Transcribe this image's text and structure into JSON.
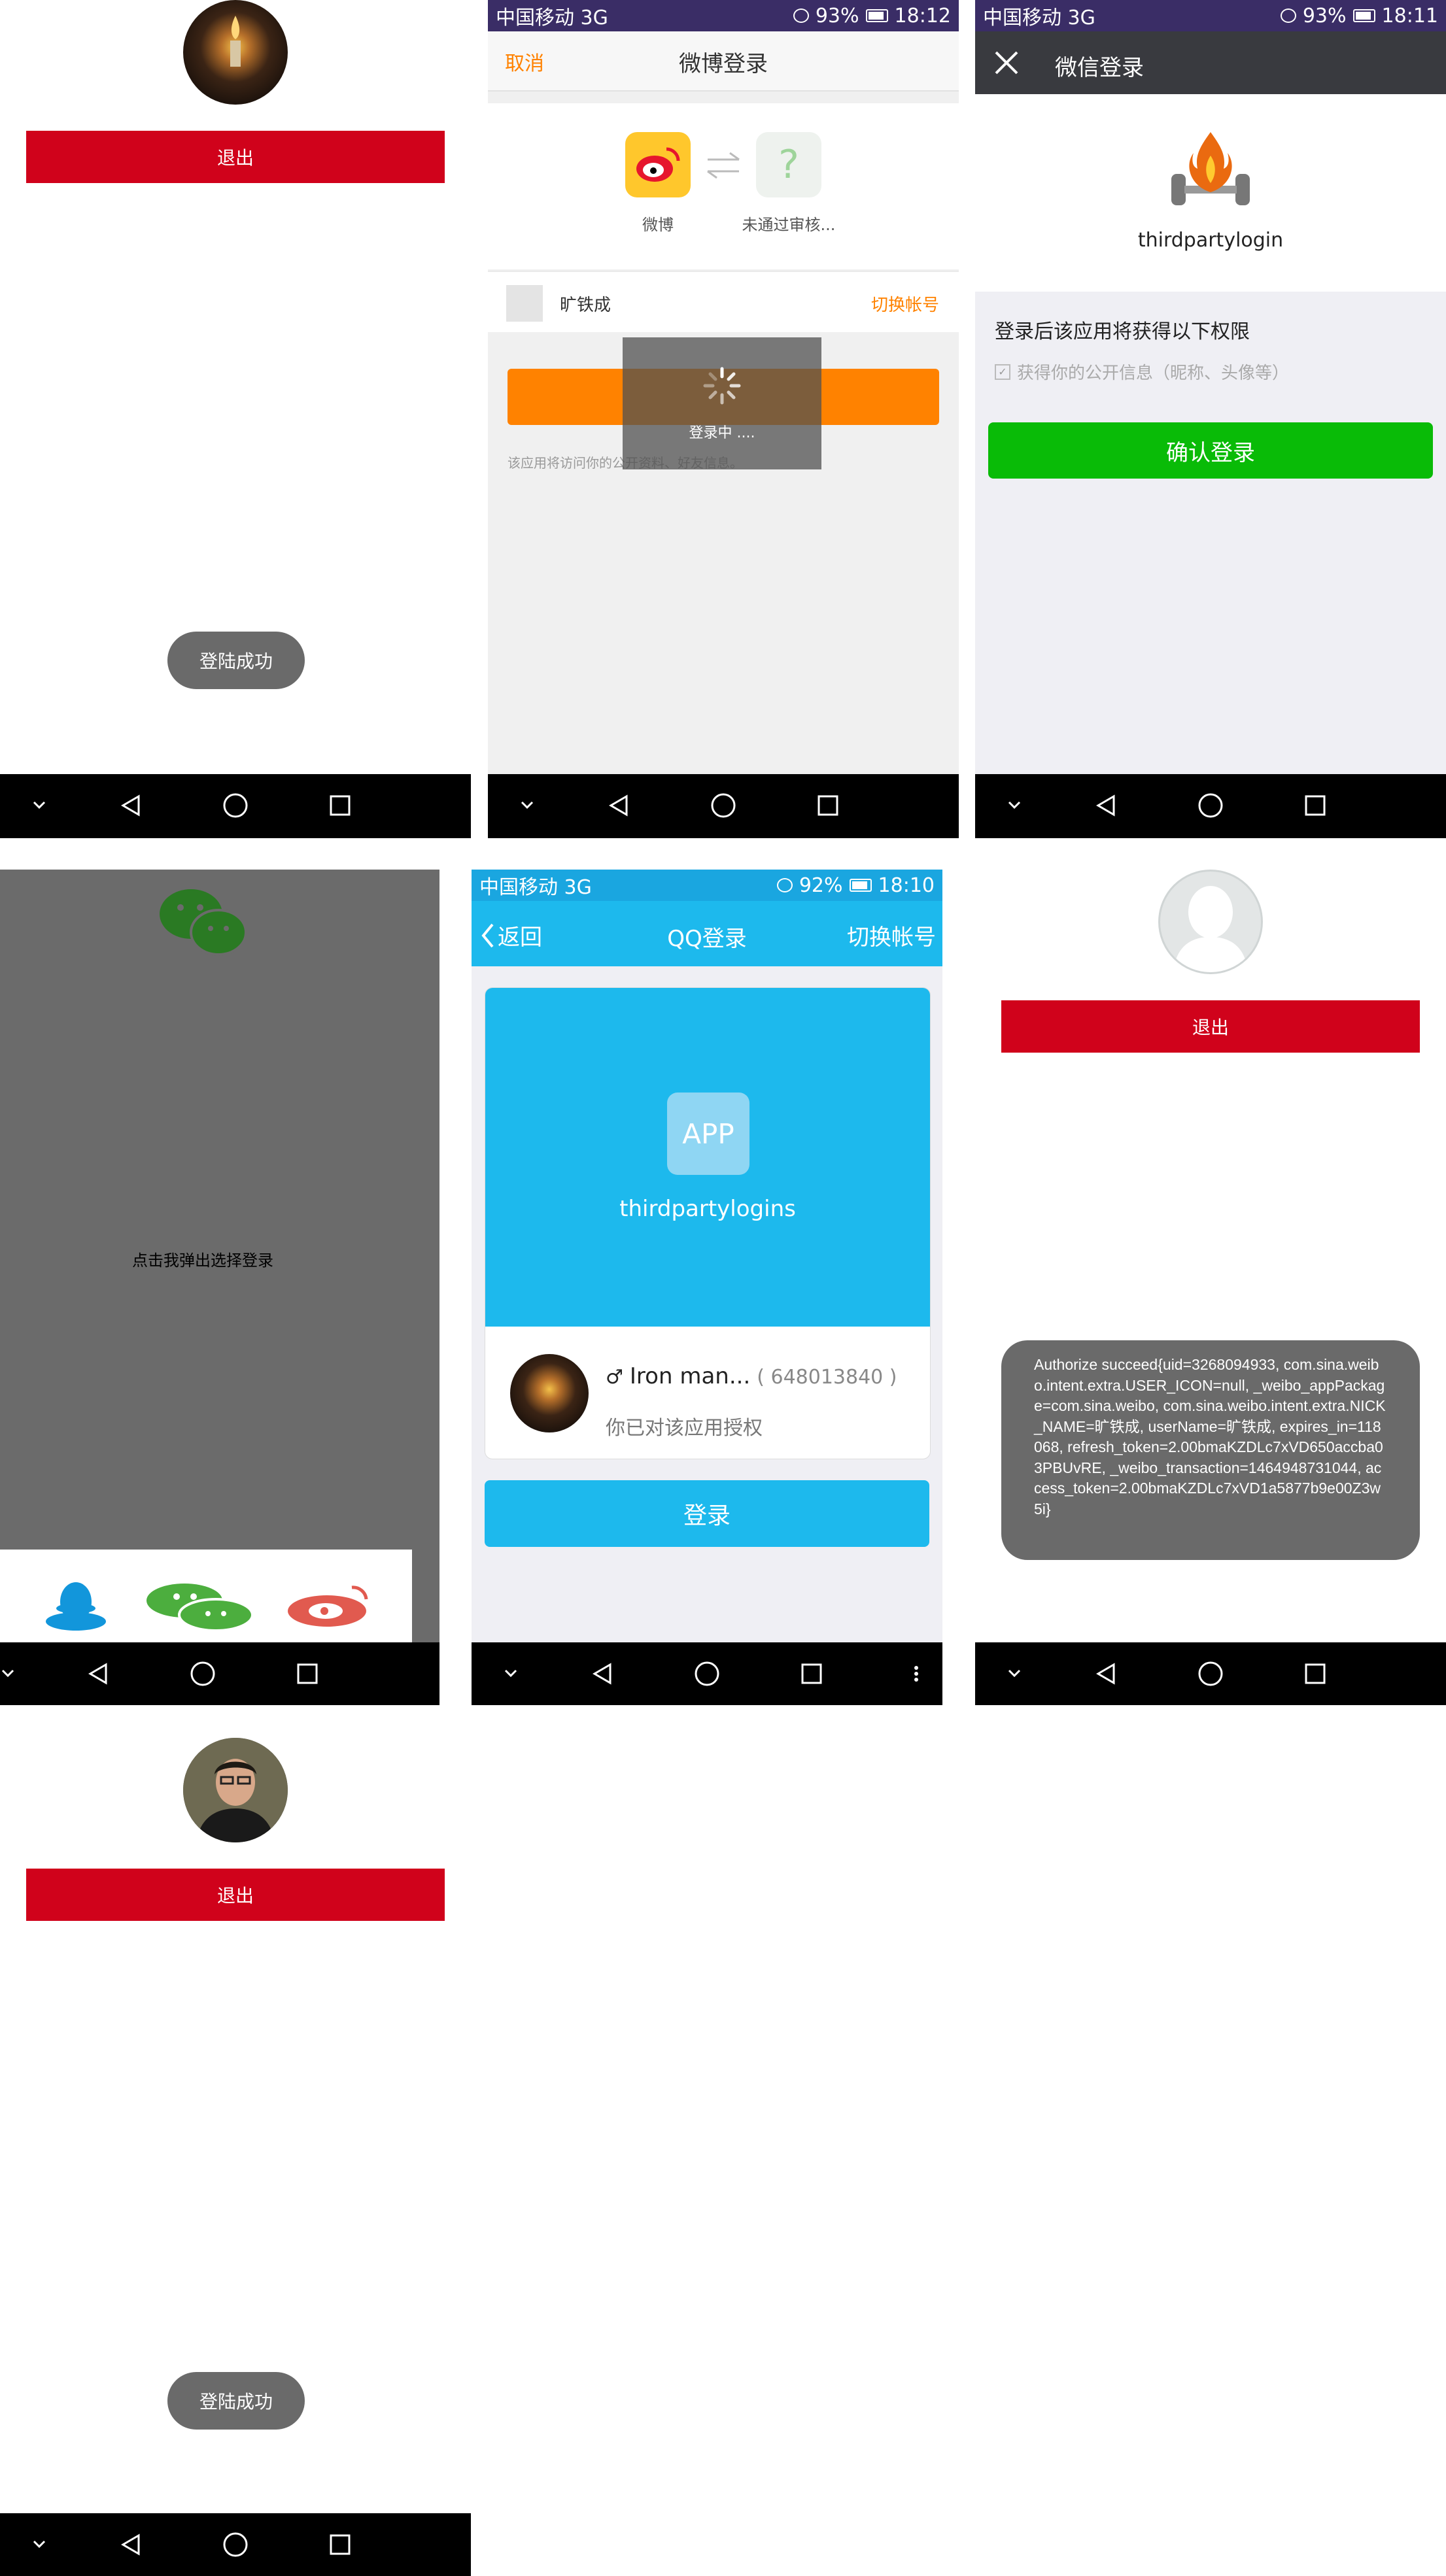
{
  "colors": {
    "red": "#d0021b",
    "weibo_orange": "#ff8200",
    "wechat_green": "#09bb07",
    "qq_blue": "#1db9ed",
    "statusbar_purple": "#3a2d66",
    "toast_gray": "#6a6a6a",
    "overlay_gray": "#6b6b6b"
  },
  "panel1": {
    "avatar_icon": "candle-avatar-icon",
    "logout_label": "退出",
    "toast": "登陆成功"
  },
  "weibo": {
    "status_left": "中国移动 3G",
    "status_battery": "93%",
    "status_time": "18:12",
    "cancel": "取消",
    "title": "微博登录",
    "app1_label": "微博",
    "app2_label": "未通过审核...",
    "user_name": "旷铁成",
    "switch_account": "切换帐号",
    "loading": "登录中 ....",
    "note": "该应用将访问你的公开资料、好友信息。"
  },
  "wechat": {
    "status_left": "中国移动 3G",
    "status_battery": "93%",
    "status_time": "18:11",
    "title": "微信登录",
    "app_name": "thirdpartylogin",
    "perm_title": "登录后该应用将获得以下权限",
    "perm_item": "获得你的公开信息（昵称、头像等）",
    "confirm": "确认登录"
  },
  "chooser": {
    "center_text": "点击我弹出选择登录",
    "icons": [
      "qq-icon",
      "wechat-icon",
      "weibo-icon"
    ]
  },
  "qq": {
    "status_left": "中国移动 3G",
    "status_battery": "92%",
    "status_time": "18:10",
    "back": "返回",
    "title": "QQ登录",
    "switch_account": "切换帐号",
    "app_badge": "APP",
    "app_name": "thirdpartylogins",
    "user_name": "Iron man...",
    "user_id": "( 648013840 )",
    "granted": "你已对该应用授权",
    "login": "登录"
  },
  "panel6": {
    "logout_label": "退出",
    "toast_text": "Authorize succeed{uid=3268094933, com.sina.weibo.intent.extra.USER_ICON=null, _weibo_appPackage=com.sina.weibo, com.sina.weibo.intent.extra.NICK_NAME=旷铁成, userName=旷铁成, expires_in=118068, refresh_token=2.00bmaKZDLc7xVD650accba03PBUvRE, _weibo_transaction=1464948731044, access_token=2.00bmaKZDLc7xVD1a5877b9e00Z3w5i}"
  },
  "panel7": {
    "logout_label": "退出",
    "toast": "登陆成功"
  }
}
